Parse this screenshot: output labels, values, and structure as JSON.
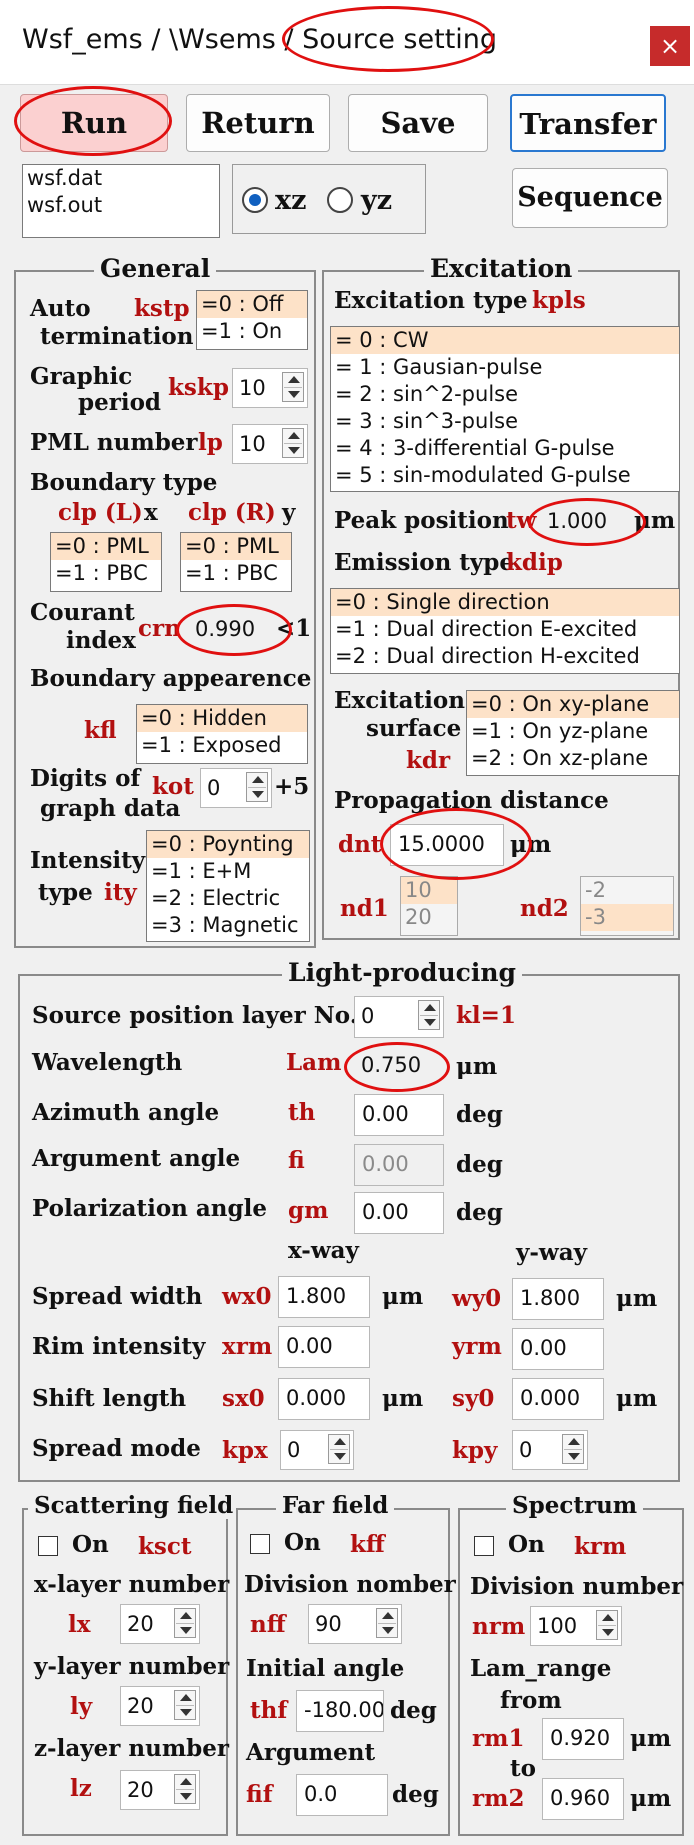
{
  "window": {
    "title": "Wsf_ems / \\Wsems / Source setting",
    "close": "×"
  },
  "toolbar": {
    "run": "Run",
    "return": "Return",
    "save": "Save",
    "transfer": "Transfer",
    "sequence": "Sequence"
  },
  "files": [
    "wsf.dat",
    "wsf.out"
  ],
  "plane": {
    "xz": "xz",
    "yz": "yz",
    "selected": "xz"
  },
  "general": {
    "title": "General",
    "auto_termination": {
      "label1": "Auto",
      "label2": "termination",
      "var": "kstp",
      "options": [
        "=0 : Off",
        "=1 : On"
      ]
    },
    "graphic_period": {
      "label1": "Graphic",
      "label2": "period",
      "var": "kskp",
      "value": "10"
    },
    "pml_number": {
      "label": "PML number",
      "var": "lp",
      "value": "10"
    },
    "boundary_type": {
      "label": "Boundary type",
      "left_var": "clp (L)",
      "left_axis": "x",
      "right_var": "clp (R)",
      "right_axis": "y",
      "left_options": [
        "=0 : PML",
        "=1 : PBC"
      ],
      "right_options": [
        "=0 : PML",
        "=1 : PBC"
      ]
    },
    "courant": {
      "label1": "Courant",
      "label2": "index",
      "var": "crn",
      "value": "0.990",
      "suffix": "<1"
    },
    "boundary_appearance": {
      "label": "Boundary appearence",
      "var": "kfl",
      "options": [
        "=0 : Hidden",
        "=1 : Exposed"
      ]
    },
    "digits": {
      "label1": "Digits of",
      "label2": "graph data",
      "var": "kot",
      "value": "0",
      "suffix": "+5"
    },
    "intensity": {
      "label1": "Intensity",
      "label2": "type",
      "var": "ity",
      "options": [
        "=0 : Poynting",
        "=1 : E+M",
        "=2 : Electric",
        "=3 : Magnetic"
      ]
    }
  },
  "excitation": {
    "title": "Excitation",
    "type_label": "Excitation type",
    "type_var": "kpls",
    "types": [
      "= 0 : CW",
      "= 1 : Gausian-pulse",
      "= 2 : sin^2-pulse",
      "= 3 : sin^3-pulse",
      "= 4 : 3-differential G-pulse",
      "= 5 : sin-modulated G-pulse"
    ],
    "peak_label": "Peak position",
    "peak_var": "tw",
    "peak_value": "1.000",
    "peak_unit": "μm",
    "emission_label": "Emission type",
    "emission_var": "kdip",
    "emissions": [
      "=0 : Single direction",
      "=1 : Dual direction E-excited",
      "=2 : Dual direction H-excited"
    ],
    "surface_label1": "Excitation",
    "surface_label2": "surface",
    "surface_var": "kdr",
    "surfaces": [
      "=0 : On xy-plane",
      "=1 : On yz-plane",
      "=2 : On xz-plane"
    ],
    "prop_label": "Propagation distance",
    "prop_var": "dnt",
    "prop_value": "15.0000",
    "prop_unit": "μm",
    "nd1_var": "nd1",
    "nd1_items": [
      "10",
      "20"
    ],
    "nd2_var": "nd2",
    "nd2_items": [
      "-2",
      "-3"
    ]
  },
  "light": {
    "title": "Light-producing",
    "src_label": "Source position layer No.",
    "src_value": "0",
    "src_note": "kl=1",
    "wl_label": "Wavelength",
    "wl_var": "Lam",
    "wl_value": "0.750",
    "wl_unit": "μm",
    "az_label": "Azimuth angle",
    "az_var": "th",
    "az_value": "0.00",
    "az_unit": "deg",
    "arg_label": "Argument angle",
    "arg_var": "fi",
    "arg_value": "0.00",
    "arg_unit": "deg",
    "pol_label": "Polarization angle",
    "pol_var": "gm",
    "pol_value": "0.00",
    "pol_unit": "deg",
    "xway": "x-way",
    "yway": "y-way",
    "spread_label": "Spread width",
    "wx0": "wx0",
    "wx0_value": "1.800",
    "wy0": "wy0",
    "wy0_value": "1.800",
    "spread_unit": "μm",
    "rim_label": "Rim intensity",
    "xrm": "xrm",
    "xrm_value": "0.00",
    "yrm": "yrm",
    "yrm_value": "0.00",
    "shift_label": "Shift length",
    "sx0": "sx0",
    "sx0_value": "0.000",
    "sy0": "sy0",
    "sy0_value": "0.000",
    "shift_unit": "μm",
    "mode_label": "Spread mode",
    "kpx": "kpx",
    "kpx_value": "0",
    "kpy": "kpy",
    "kpy_value": "0"
  },
  "scattering": {
    "title": "Scattering field",
    "on": "On",
    "var": "ksct",
    "lx_label": "x-layer number",
    "lx_var": "lx",
    "lx_value": "20",
    "ly_label": "y-layer number",
    "ly_var": "ly",
    "ly_value": "20",
    "lz_label": "z-layer number",
    "lz_var": "lz",
    "lz_value": "20"
  },
  "farfield": {
    "title": "Far field",
    "on": "On",
    "var": "kff",
    "div_label": "Division nomber",
    "div_var": "nff",
    "div_value": "90",
    "init_label": "Initial angle",
    "init_var": "thf",
    "init_value": "-180.00",
    "init_unit": "deg",
    "arg_label": "Argument",
    "arg_var": "fif",
    "arg_value": "0.0",
    "arg_unit": "deg"
  },
  "spectrum": {
    "title": "Spectrum",
    "on": "On",
    "var": "krm",
    "div_label": "Division number",
    "div_var": "nrm",
    "div_value": "100",
    "range_label": "Lam_range",
    "from": "from",
    "to": "to",
    "rm1_var": "rm1",
    "rm1_value": "0.920",
    "rm2_var": "rm2",
    "rm2_value": "0.960",
    "unit": "μm"
  }
}
